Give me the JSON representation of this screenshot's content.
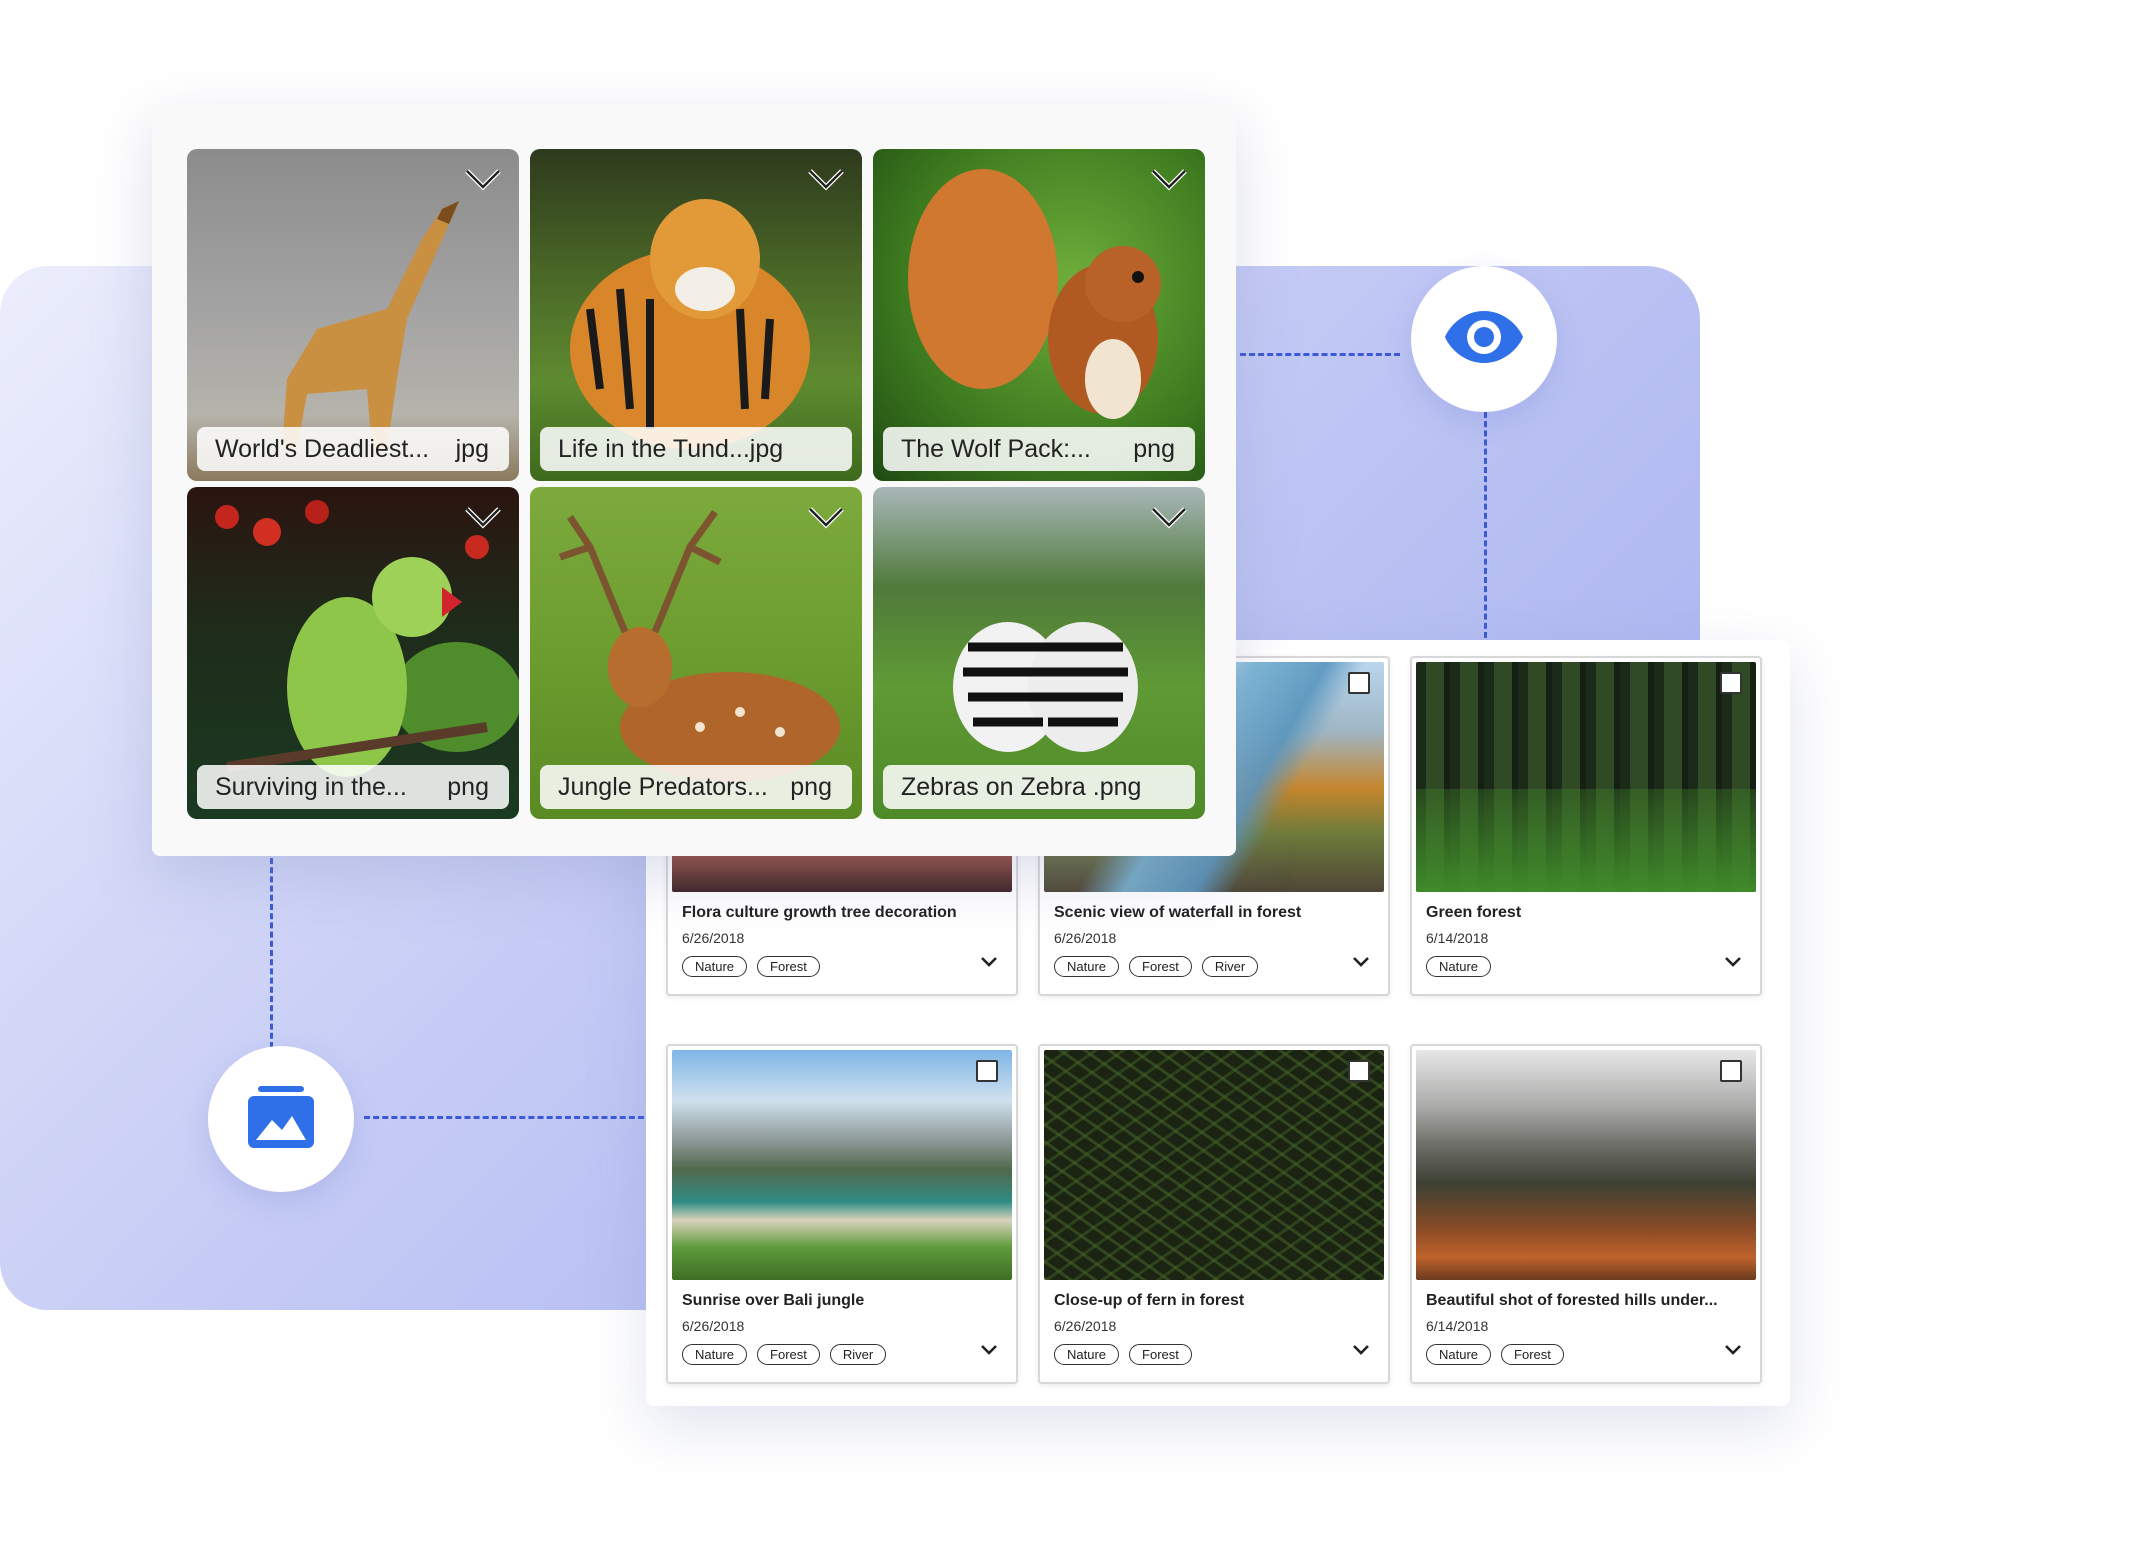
{
  "colors": {
    "accent": "#3c59d8",
    "icon_blue": "#2f6fe8",
    "panel_light": "#e3e6fb",
    "panel_dark": "#9eaaee"
  },
  "icons": {
    "eye": "eye-icon",
    "gallery": "gallery-icon"
  },
  "gallery": {
    "tiles": [
      {
        "name": "World's Deadliest...",
        "ext": "jpg"
      },
      {
        "name": "Life in the Tund...jpg",
        "ext": ""
      },
      {
        "name": "The Wolf Pack:...",
        "ext": "png"
      },
      {
        "name": "Surviving in the...",
        "ext": "png"
      },
      {
        "name": "Jungle Predators...",
        "ext": "png"
      },
      {
        "name": "Zebras on Zebra .png",
        "ext": ""
      }
    ]
  },
  "list": {
    "items": [
      {
        "title": "Flora culture growth tree decoration",
        "date": "6/26/2018",
        "tags": [
          "Nature",
          "Forest"
        ]
      },
      {
        "title": "Scenic view of waterfall in forest",
        "date": "6/26/2018",
        "tags": [
          "Nature",
          "Forest",
          "River"
        ]
      },
      {
        "title": "Green forest",
        "date": "6/14/2018",
        "tags": [
          "Nature"
        ]
      },
      {
        "title": "Sunrise over Bali jungle",
        "date": "6/26/2018",
        "tags": [
          "Nature",
          "Forest",
          "River"
        ]
      },
      {
        "title": "Close-up of fern in forest",
        "date": "6/26/2018",
        "tags": [
          "Nature",
          "Forest"
        ]
      },
      {
        "title": "Beautiful shot of forested hills under...",
        "date": "6/14/2018",
        "tags": [
          "Nature",
          "Forest"
        ]
      }
    ]
  }
}
